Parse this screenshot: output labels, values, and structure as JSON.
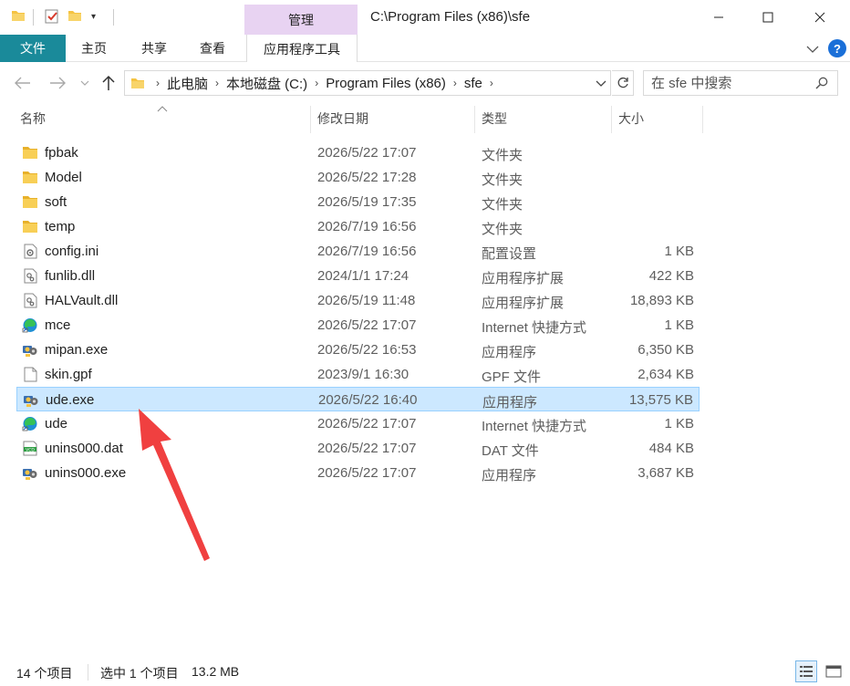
{
  "window": {
    "title": "C:\\Program Files (x86)\\sfe",
    "context_tab": "管理"
  },
  "ribbon": {
    "tabs": [
      "文件",
      "主页",
      "共享",
      "查看",
      "应用程序工具"
    ]
  },
  "address": {
    "crumbs": [
      "此电脑",
      "本地磁盘 (C:)",
      "Program Files (x86)",
      "sfe"
    ]
  },
  "search": {
    "placeholder": "在 sfe 中搜索"
  },
  "columns": {
    "name": "名称",
    "date": "修改日期",
    "type": "类型",
    "size": "大小"
  },
  "files": [
    {
      "name": "fpbak",
      "date": "2026/5/22 17:07",
      "type": "文件夹",
      "size": "",
      "icon": "folder-icon"
    },
    {
      "name": "Model",
      "date": "2026/5/22 17:28",
      "type": "文件夹",
      "size": "",
      "icon": "folder-icon"
    },
    {
      "name": "soft",
      "date": "2026/5/19 17:35",
      "type": "文件夹",
      "size": "",
      "icon": "folder-icon"
    },
    {
      "name": "temp",
      "date": "2026/7/19 16:56",
      "type": "文件夹",
      "size": "",
      "icon": "folder-icon"
    },
    {
      "name": "config.ini",
      "date": "2026/7/19 16:56",
      "type": "配置设置",
      "size": "1 KB",
      "icon": "settings-file-icon"
    },
    {
      "name": "funlib.dll",
      "date": "2024/1/1 17:24",
      "type": "应用程序扩展",
      "size": "422 KB",
      "icon": "dll-file-icon"
    },
    {
      "name": "HALVault.dll",
      "date": "2026/5/19 11:48",
      "type": "应用程序扩展",
      "size": "18,893 KB",
      "icon": "dll-file-icon"
    },
    {
      "name": "mce",
      "date": "2026/5/22 17:07",
      "type": "Internet 快捷方式",
      "size": "1 KB",
      "icon": "edge-shortcut-icon"
    },
    {
      "name": "mipan.exe",
      "date": "2026/5/22 16:53",
      "type": "应用程序",
      "size": "6,350 KB",
      "icon": "exe-icon"
    },
    {
      "name": "skin.gpf",
      "date": "2023/9/1 16:30",
      "type": "GPF 文件",
      "size": "2,634 KB",
      "icon": "blank-file-icon"
    },
    {
      "name": "ude.exe",
      "date": "2026/5/22 16:40",
      "type": "应用程序",
      "size": "13,575 KB",
      "icon": "exe-icon",
      "selected": true
    },
    {
      "name": "ude",
      "date": "2026/5/22 17:07",
      "type": "Internet 快捷方式",
      "size": "1 KB",
      "icon": "edge-shortcut-icon"
    },
    {
      "name": "unins000.dat",
      "date": "2026/5/22 17:07",
      "type": "DAT 文件",
      "size": "484 KB",
      "icon": "vcd-file-icon"
    },
    {
      "name": "unins000.exe",
      "date": "2026/5/22 17:07",
      "type": "应用程序",
      "size": "3,687 KB",
      "icon": "exe-icon"
    }
  ],
  "status": {
    "count": "14 个项目",
    "selected": "选中 1 个项目",
    "selected_size": "13.2 MB"
  },
  "colors": {
    "file_tab": "#1a8a9a",
    "manage_tab": "#e8d3f2",
    "selection_bg": "#cce8ff",
    "selection_border": "#99d1ff",
    "folder": "#f5c342",
    "annotation_arrow": "#f04040"
  }
}
